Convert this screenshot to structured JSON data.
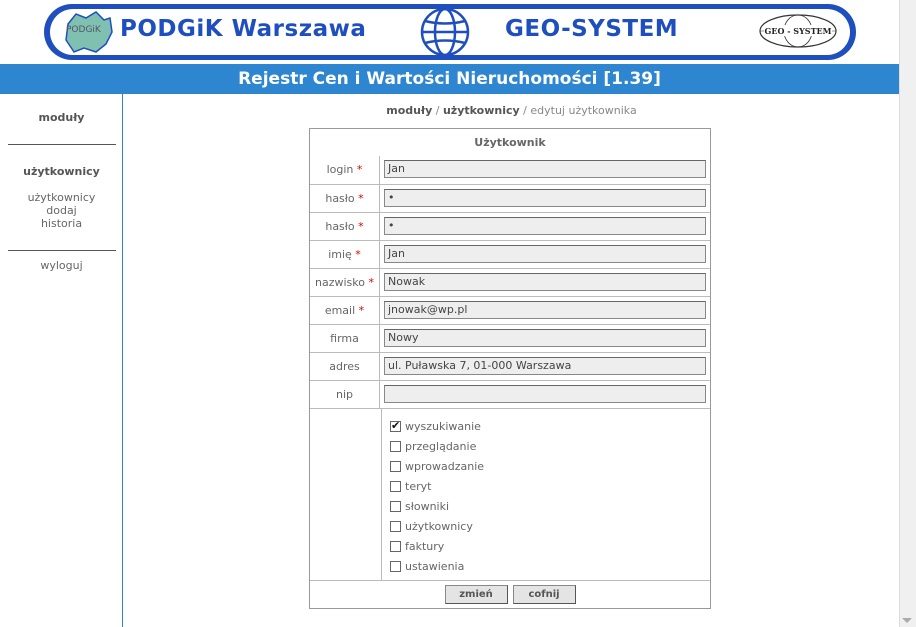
{
  "banner": {
    "left_text": "PODGiK  Warszawa",
    "right_text": "GEO-SYSTEM",
    "map_badge": "PODGiK",
    "geo_badge": "GEO - SYSTEM",
    "brand_color": "#1f4fbf"
  },
  "title": "Rejestr Cen i Wartości Nieruchomości [1.39]",
  "title_bar_color": "#2e86d1",
  "sidebar": {
    "moduly_label": "moduły",
    "users_header": "użytkownicy",
    "links": [
      "użytkownicy",
      "dodaj",
      "historia"
    ],
    "logout": "wyloguj"
  },
  "breadcrumb": {
    "part1": "moduły",
    "sep": " / ",
    "part2": "użytkownicy",
    "part3": "edytuj użytkownika"
  },
  "form": {
    "title": "Użytkownik",
    "required_mark": "*",
    "fields": [
      {
        "label": "login",
        "required": true,
        "value": "Jan"
      },
      {
        "label": "hasło",
        "required": true,
        "value": "•"
      },
      {
        "label": "hasło",
        "required": true,
        "value": "•"
      },
      {
        "label": "imię",
        "required": true,
        "value": "Jan"
      },
      {
        "label": "nazwisko",
        "required": true,
        "value": "Nowak"
      },
      {
        "label": "email",
        "required": true,
        "value": "jnowak@wp.pl"
      },
      {
        "label": "firma",
        "required": false,
        "value": "Nowy"
      },
      {
        "label": "adres",
        "required": false,
        "value": "ul. Puławska 7, 01-000 Warszawa"
      },
      {
        "label": "nip",
        "required": false,
        "value": ""
      }
    ],
    "permissions": [
      {
        "label": "wyszukiwanie",
        "checked": true
      },
      {
        "label": "przeglądanie",
        "checked": false
      },
      {
        "label": "wprowadzanie",
        "checked": false
      },
      {
        "label": "teryt",
        "checked": false
      },
      {
        "label": "słowniki",
        "checked": false
      },
      {
        "label": "użytkownicy",
        "checked": false
      },
      {
        "label": "faktury",
        "checked": false
      },
      {
        "label": "ustawienia",
        "checked": false
      }
    ],
    "submit_label": "zmień",
    "cancel_label": "cofnij"
  }
}
